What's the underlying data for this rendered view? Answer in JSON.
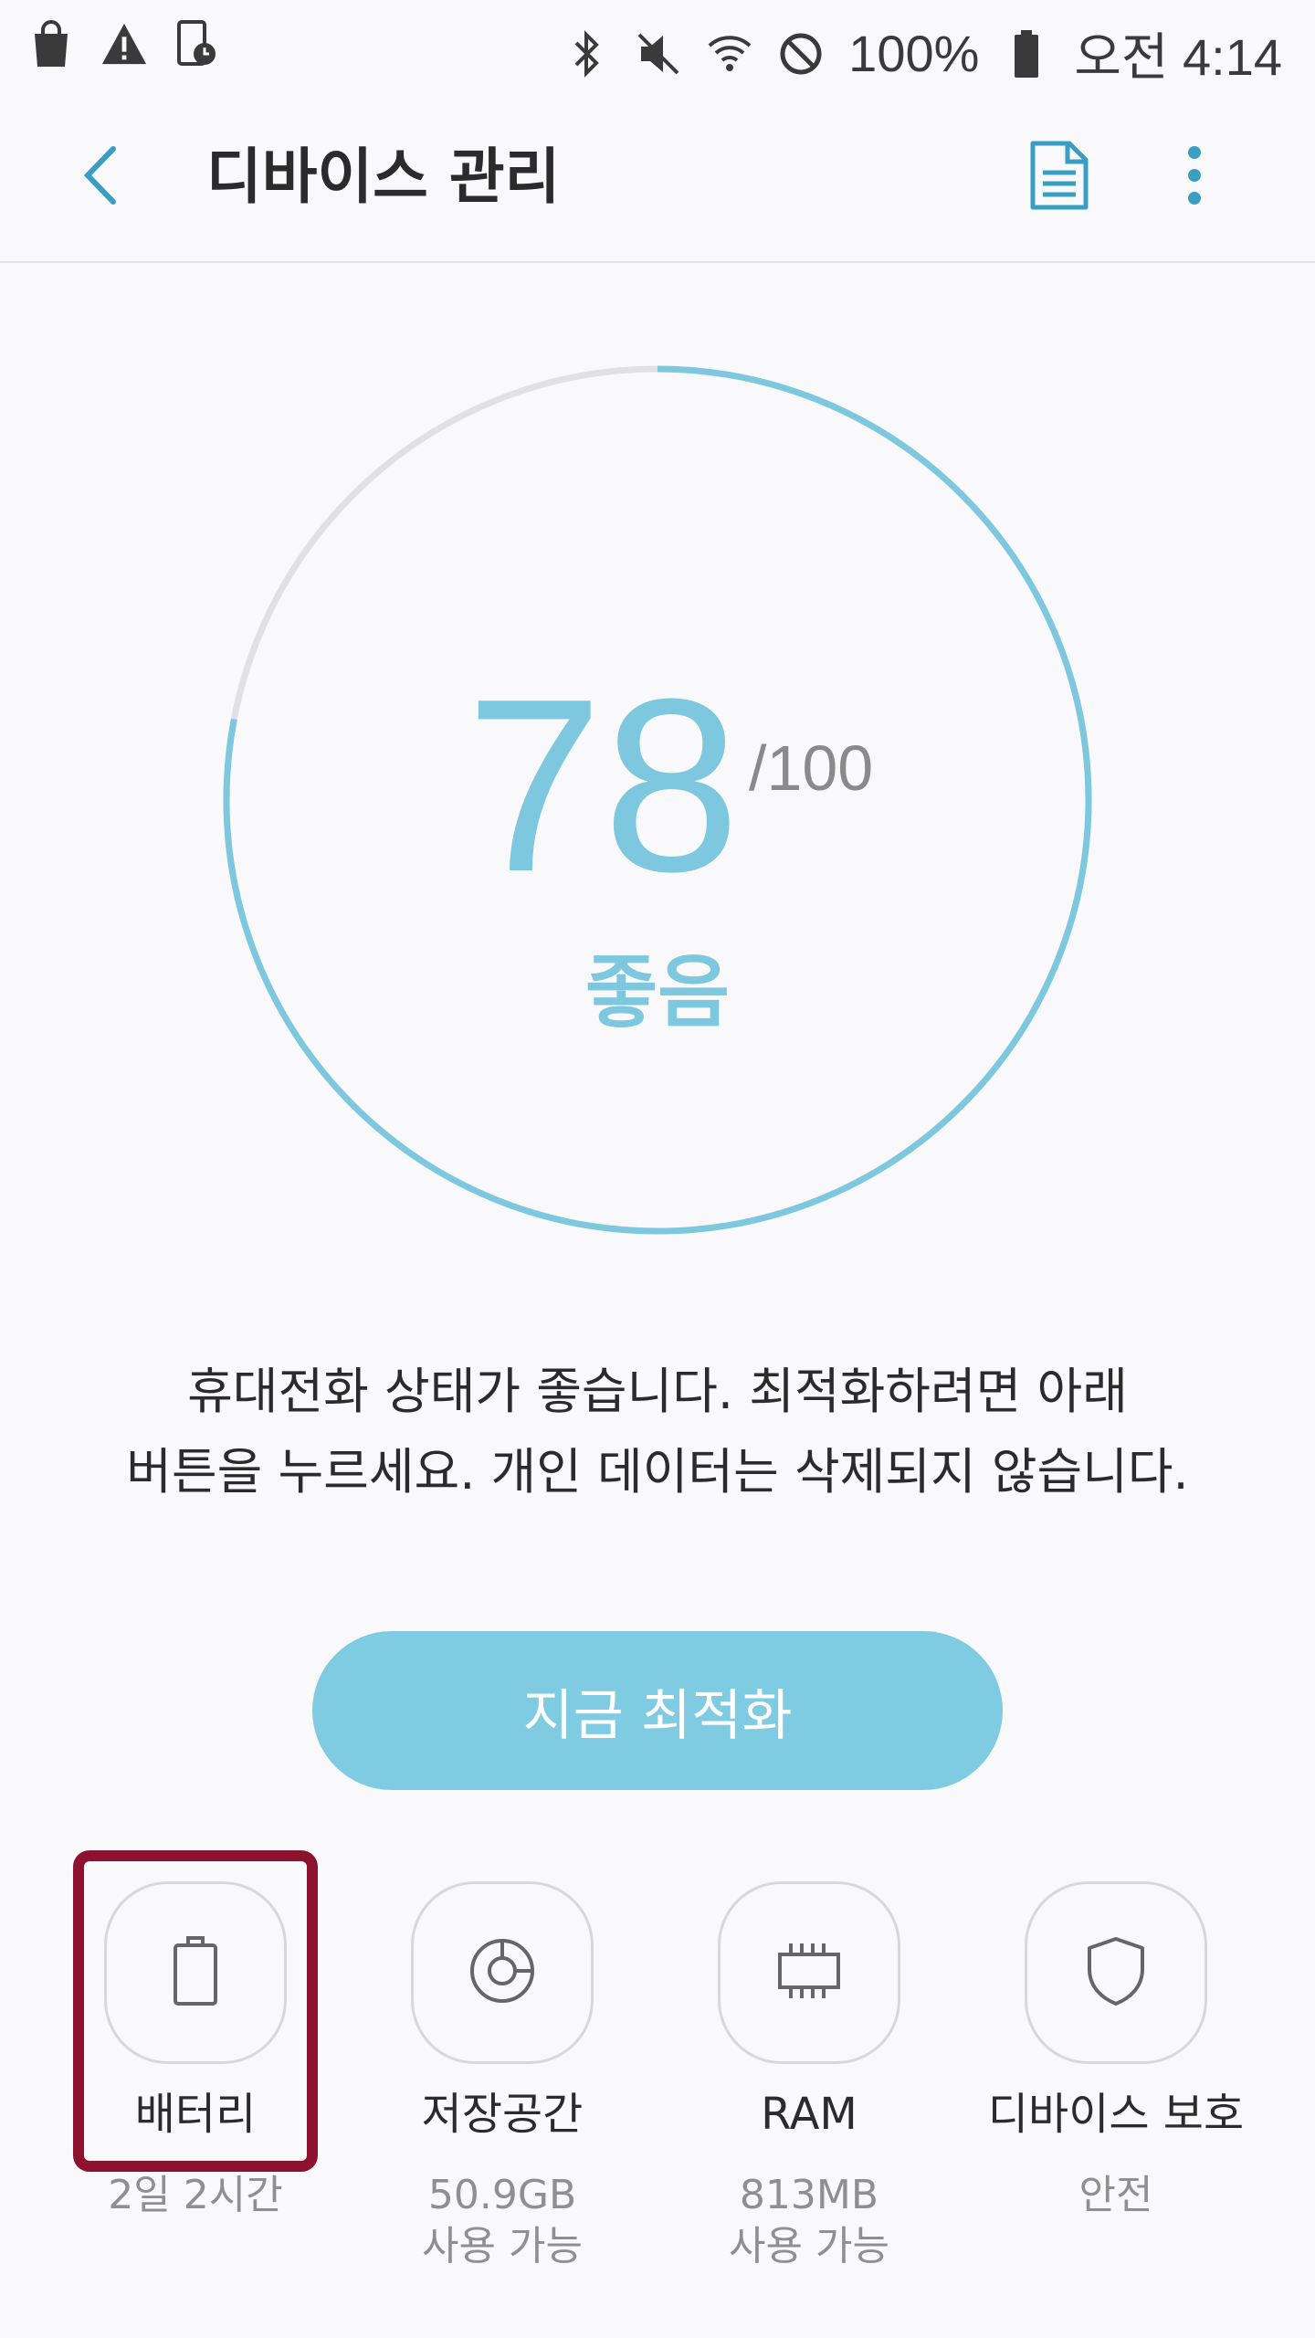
{
  "status_bar": {
    "battery_text": "100%",
    "time": "오전 4:14",
    "left_icons": [
      "shopping-bag-icon",
      "warning-icon",
      "device-clock-icon"
    ],
    "right_icons": [
      "bluetooth-icon",
      "mute-icon",
      "wifi-icon",
      "block-icon",
      "battery-icon"
    ]
  },
  "app_bar": {
    "title": "디바이스 관리",
    "back_icon": "chevron-left-icon",
    "report_icon": "document-icon",
    "more_icon": "more-vert-icon"
  },
  "score": {
    "value": "78",
    "max": "/100",
    "label": "좋음",
    "fraction": 0.78,
    "accent_color": "#7ec8df",
    "track_color": "#e1e1e3"
  },
  "description": {
    "line1": "휴대전화 상태가 좋습니다. 최적화하려면 아래",
    "line2": "버튼을 누르세요. 개인 데이터는 삭제되지 않습니다."
  },
  "optimize_button": {
    "label": "지금 최적화",
    "color": "#7ecbe2"
  },
  "tiles": [
    {
      "title": "배터리",
      "sub": "2일 2시간",
      "sub2": "",
      "icon": "battery-icon",
      "highlighted": true
    },
    {
      "title": "저장공간",
      "sub": "50.9GB",
      "sub2": "사용 가능",
      "icon": "storage-icon"
    },
    {
      "title": "RAM",
      "sub": "813MB",
      "sub2": "사용 가능",
      "icon": "memory-chip-icon"
    },
    {
      "title": "디바이스 보호",
      "sub": "안전",
      "sub2": "",
      "icon": "shield-icon"
    }
  ],
  "highlight_color": "#8c1230"
}
